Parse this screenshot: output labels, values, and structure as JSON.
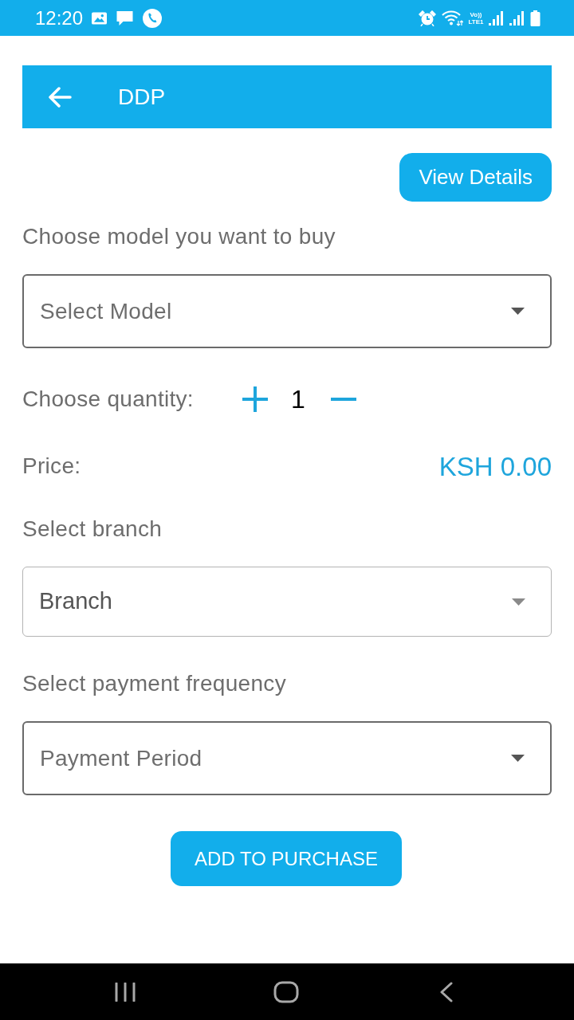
{
  "status_bar": {
    "time": "12:20",
    "network_label": "Vo)) LTE1"
  },
  "app_bar": {
    "title": "DDP"
  },
  "details_button": {
    "label": "View Details"
  },
  "sections": [
    {
      "kind": "dropdown",
      "label": "Choose model you want to buy",
      "placeholder": "Select Model"
    },
    {
      "kind": "quantity",
      "label": "Choose quantity:",
      "value": "1"
    },
    {
      "kind": "price",
      "label": "Price:",
      "value": "KSH 0.00"
    },
    {
      "kind": "picker",
      "label": "Select branch",
      "placeholder": "Branch"
    },
    {
      "kind": "dropdown",
      "label": "Select payment frequency",
      "placeholder": "Payment Period"
    }
  ],
  "submit_button": {
    "label": "ADD TO PURCHASE"
  }
}
